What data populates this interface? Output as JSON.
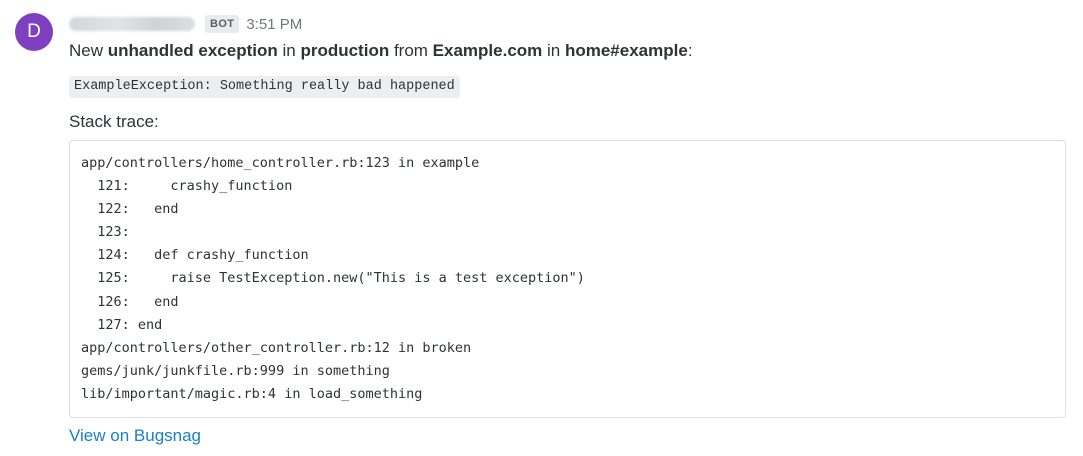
{
  "avatar": {
    "initial": "D",
    "color": "#7e3fc0"
  },
  "header": {
    "badge": "BOT",
    "time": "3:51 PM"
  },
  "summary": {
    "prefix": "New ",
    "error_class": "unhandled exception",
    "in_text": " in ",
    "stage": "production",
    "from_text": " from ",
    "project": "Example.com",
    "in_text_2": " in ",
    "context": "home#example",
    "suffix": ":"
  },
  "exception": {
    "message": "ExampleException: Something really bad happened"
  },
  "stack": {
    "title": "Stack trace:",
    "lines": [
      "app/controllers/home_controller.rb:123 in example",
      "  121:     crashy_function",
      "  122:   end",
      "  123:",
      "  124:   def crashy_function",
      "  125:     raise TestException.new(\"This is a test exception\")",
      "  126:   end",
      "  127: end",
      "app/controllers/other_controller.rb:12 in broken",
      "gems/junk/junkfile.rb:999 in something",
      "lib/important/magic.rb:4 in load_something"
    ]
  },
  "link": {
    "label": "View on Bugsnag",
    "color": "#1a7fc9"
  }
}
